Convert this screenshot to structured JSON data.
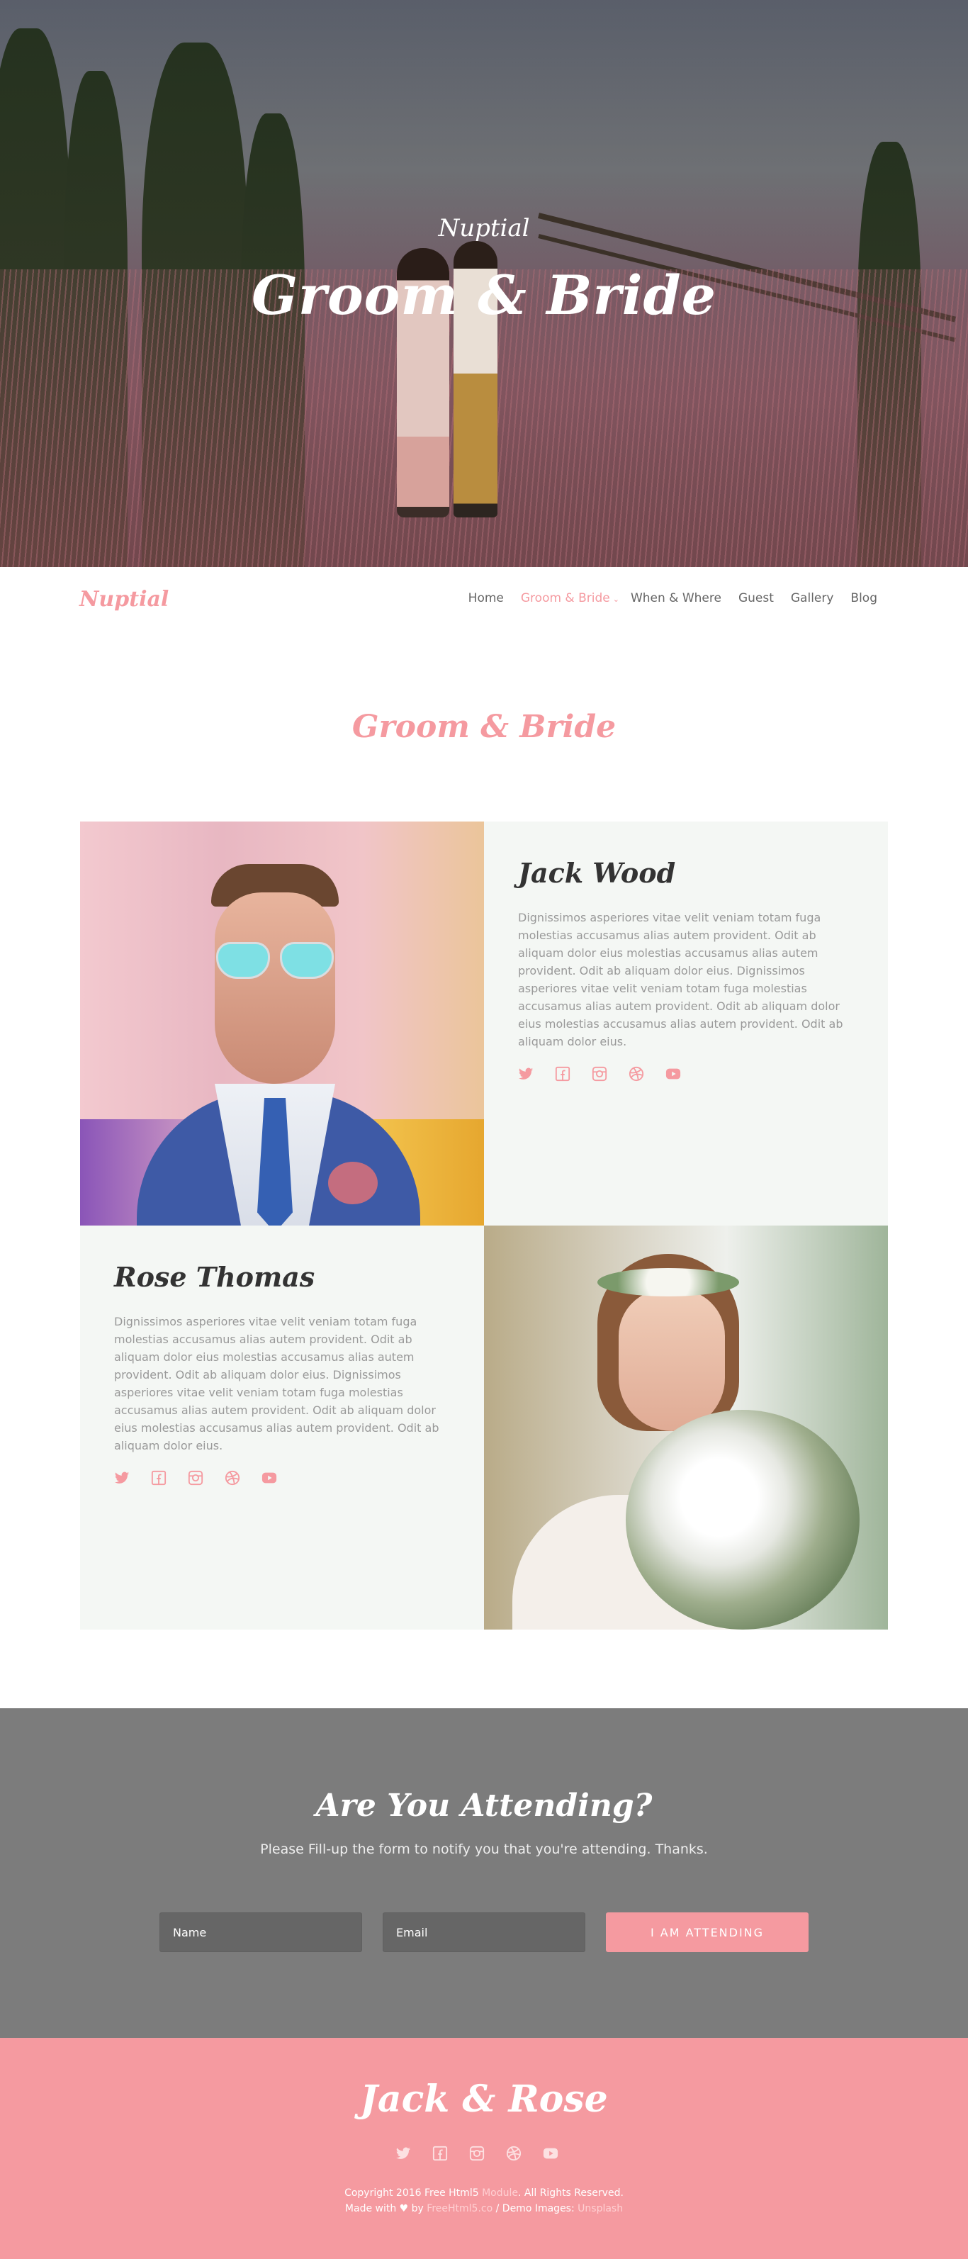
{
  "hero": {
    "subtitle": "Nuptial",
    "title": "Groom & Bride"
  },
  "nav": {
    "logo": "Nuptial",
    "items": [
      {
        "label": "Home",
        "active": false
      },
      {
        "label": "Groom & Bride",
        "active": true,
        "dropdown": true
      },
      {
        "label": "When & Where",
        "active": false
      },
      {
        "label": "Guest",
        "active": false
      },
      {
        "label": "Gallery",
        "active": false
      },
      {
        "label": "Blog",
        "active": false
      }
    ]
  },
  "couple": {
    "section_title": "Groom & Bride",
    "groom": {
      "name": "Jack Wood",
      "bio": "Dignissimos asperiores vitae velit veniam totam fuga molestias accusamus alias autem provident. Odit ab aliquam dolor eius molestias accusamus alias autem provident. Odit ab aliquam dolor eius. Dignissimos asperiores vitae velit veniam totam fuga molestias accusamus alias autem provident. Odit ab aliquam dolor eius molestias accusamus alias autem provident. Odit ab aliquam dolor eius."
    },
    "bride": {
      "name": "Rose Thomas",
      "bio": "Dignissimos asperiores vitae velit veniam totam fuga molestias accusamus alias autem provident. Odit ab aliquam dolor eius molestias accusamus alias autem provident. Odit ab aliquam dolor eius. Dignissimos asperiores vitae velit veniam totam fuga molestias accusamus alias autem provident. Odit ab aliquam dolor eius molestias accusamus alias autem provident. Odit ab aliquam dolor eius."
    },
    "social_icons": [
      "twitter-icon",
      "facebook-icon",
      "instagram-icon",
      "dribbble-icon",
      "youtube-icon"
    ]
  },
  "rsvp": {
    "title": "Are You Attending?",
    "subtitle": "Please Fill-up the form to notify you that you're attending. Thanks.",
    "name_placeholder": "Name",
    "email_placeholder": "Email",
    "button_label": "I AM ATTENDING"
  },
  "footer": {
    "title": "Jack & Rose",
    "copyright_prefix": "Copyright 2016 Free Html5 ",
    "copyright_link": "Module",
    "copyright_suffix": ". All Rights Reserved.",
    "made_with": "Made with ♥ by ",
    "made_link": "FreeHtml5.co",
    "demo_images": " / Demo Images: ",
    "images_link": "Unsplash"
  },
  "colors": {
    "accent": "#f59aa0",
    "card_bg": "#f4f7f4",
    "rsvp_bg": "#7c7c7c"
  }
}
